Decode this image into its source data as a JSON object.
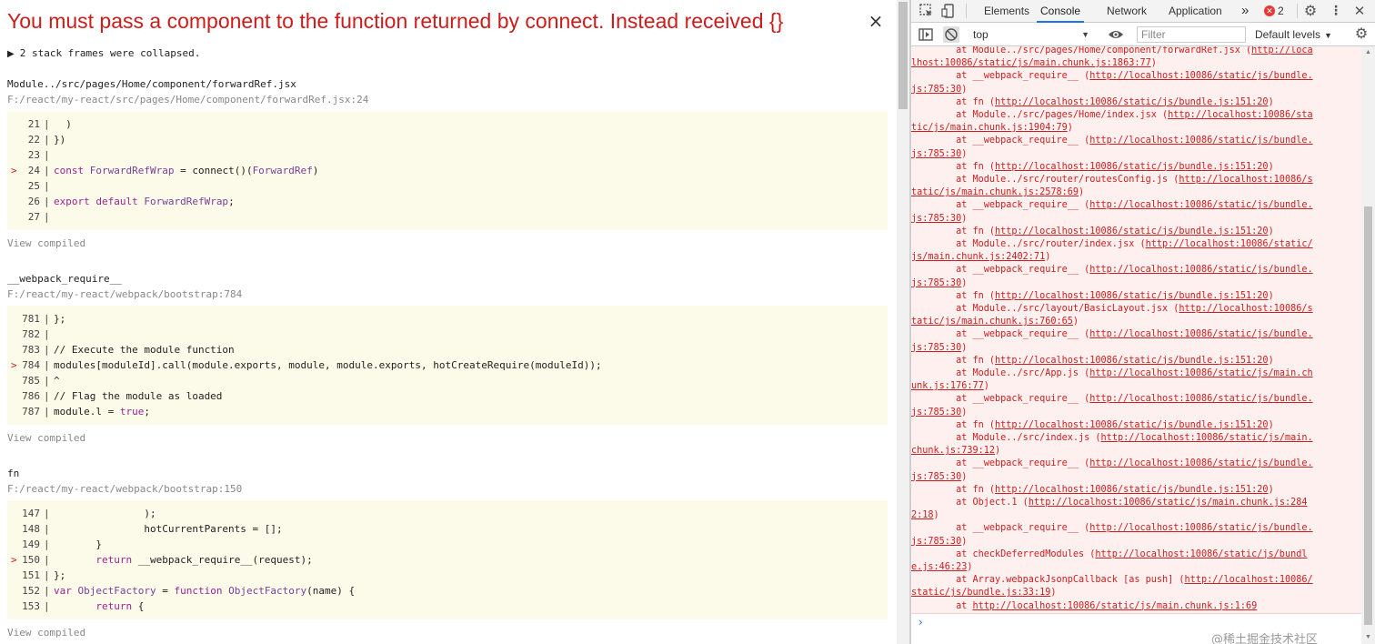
{
  "overlay": {
    "title": "You must pass a component to the function returned by connect. Instead received {}",
    "close_glyph": "×",
    "collapsed": "2 stack frames were collapsed.",
    "view_compiled": "View compiled",
    "frames": [
      {
        "name": "Module../src/pages/Home/component/forwardRef.jsx",
        "file": "F:/react/my-react/src/pages/Home/component/forwardRef.jsx:24",
        "lines": [
          {
            "n": "21",
            "mark": false,
            "parts": [
              {
                "t": "  )",
                "c": ""
              }
            ]
          },
          {
            "n": "22",
            "mark": false,
            "parts": [
              {
                "t": "})",
                "c": ""
              }
            ]
          },
          {
            "n": "23",
            "mark": false,
            "parts": [
              {
                "t": "",
                "c": ""
              }
            ]
          },
          {
            "n": "24",
            "mark": true,
            "parts": [
              {
                "t": "const ",
                "c": "kw"
              },
              {
                "t": "ForwardRefWrap",
                "c": "id"
              },
              {
                "t": " = connect()(",
                "c": ""
              },
              {
                "t": "ForwardRef",
                "c": "id"
              },
              {
                "t": ")",
                "c": ""
              }
            ]
          },
          {
            "n": "25",
            "mark": false,
            "parts": [
              {
                "t": "",
                "c": ""
              }
            ]
          },
          {
            "n": "26",
            "mark": false,
            "parts": [
              {
                "t": "export default ",
                "c": "kw"
              },
              {
                "t": "ForwardRefWrap",
                "c": "id"
              },
              {
                "t": ";",
                "c": ""
              }
            ]
          },
          {
            "n": "27",
            "mark": false,
            "parts": [
              {
                "t": "",
                "c": ""
              }
            ]
          }
        ]
      },
      {
        "name": "__webpack_require__",
        "file": "F:/react/my-react/webpack/bootstrap:784",
        "lines": [
          {
            "n": "781",
            "mark": false,
            "parts": [
              {
                "t": "};",
                "c": ""
              }
            ]
          },
          {
            "n": "782",
            "mark": false,
            "parts": [
              {
                "t": "",
                "c": ""
              }
            ]
          },
          {
            "n": "783",
            "mark": false,
            "parts": [
              {
                "t": "// Execute the module function",
                "c": ""
              }
            ]
          },
          {
            "n": "784",
            "mark": true,
            "parts": [
              {
                "t": "modules[moduleId].call(module.exports, module, module.exports, hotCreateRequire(moduleId));",
                "c": ""
              }
            ]
          },
          {
            "n": "785",
            "mark": false,
            "parts": [
              {
                "t": "^",
                "c": ""
              }
            ]
          },
          {
            "n": "786",
            "mark": false,
            "parts": [
              {
                "t": "// Flag the module as loaded",
                "c": ""
              }
            ]
          },
          {
            "n": "787",
            "mark": false,
            "parts": [
              {
                "t": "module.l = ",
                "c": ""
              },
              {
                "t": "true",
                "c": "kw"
              },
              {
                "t": ";",
                "c": ""
              }
            ]
          }
        ]
      },
      {
        "name": "fn",
        "file": "F:/react/my-react/webpack/bootstrap:150",
        "lines": [
          {
            "n": "147",
            "mark": false,
            "parts": [
              {
                "t": "               );",
                "c": ""
              }
            ]
          },
          {
            "n": "148",
            "mark": false,
            "parts": [
              {
                "t": "               hotCurrentParents = [];",
                "c": ""
              }
            ]
          },
          {
            "n": "149",
            "mark": false,
            "parts": [
              {
                "t": "       }",
                "c": ""
              }
            ]
          },
          {
            "n": "150",
            "mark": true,
            "parts": [
              {
                "t": "       ",
                "c": ""
              },
              {
                "t": "return",
                "c": "kw"
              },
              {
                "t": " __webpack_require__(request);",
                "c": ""
              }
            ]
          },
          {
            "n": "151",
            "mark": false,
            "parts": [
              {
                "t": "};",
                "c": ""
              }
            ]
          },
          {
            "n": "152",
            "mark": false,
            "parts": [
              {
                "t": "var ",
                "c": "kw"
              },
              {
                "t": "ObjectFactory",
                "c": "id"
              },
              {
                "t": " = ",
                "c": ""
              },
              {
                "t": "function ",
                "c": "kw"
              },
              {
                "t": "ObjectFactory",
                "c": "id"
              },
              {
                "t": "(name) {",
                "c": ""
              }
            ]
          },
          {
            "n": "153",
            "mark": false,
            "parts": [
              {
                "t": "       ",
                "c": ""
              },
              {
                "t": "return",
                "c": "kw"
              },
              {
                "t": " {",
                "c": ""
              }
            ]
          }
        ]
      }
    ]
  },
  "devtools": {
    "tabs": [
      "Elements",
      "Console",
      "Network",
      "Application"
    ],
    "active_tab": "Console",
    "more_tabs": "»",
    "error_count": "2",
    "context": "top",
    "filter_placeholder": "Filter",
    "levels": "Default levels",
    "watermark": "@稀土掘金技术社区",
    "colors": {
      "error_text": "#cc2020",
      "error_bg": "#fff0f0",
      "accent": "#1a73e8"
    },
    "log_lines": [
      [
        {
          "t": "        at Module../src/pages/Home/component/forwardRef.jsx ("
        },
        {
          "t": "http://loca",
          "l": true
        }
      ],
      [
        {
          "t": "lhost:10086/static/js/main.chunk.js:1863:77",
          "l": true
        },
        {
          "t": ")"
        }
      ],
      [
        {
          "t": "        at __webpack_require__ ("
        },
        {
          "t": "http://localhost:10086/static/js/bundle.",
          "l": true
        }
      ],
      [
        {
          "t": "js:785:30",
          "l": true
        },
        {
          "t": ")"
        }
      ],
      [
        {
          "t": "        at fn ("
        },
        {
          "t": "http://localhost:10086/static/js/bundle.js:151:20",
          "l": true
        },
        {
          "t": ")"
        }
      ],
      [
        {
          "t": "        at Module../src/pages/Home/index.jsx ("
        },
        {
          "t": "http://localhost:10086/sta",
          "l": true
        }
      ],
      [
        {
          "t": "tic/js/main.chunk.js:1904:79",
          "l": true
        },
        {
          "t": ")"
        }
      ],
      [
        {
          "t": "        at __webpack_require__ ("
        },
        {
          "t": "http://localhost:10086/static/js/bundle.",
          "l": true
        }
      ],
      [
        {
          "t": "js:785:30",
          "l": true
        },
        {
          "t": ")"
        }
      ],
      [
        {
          "t": "        at fn ("
        },
        {
          "t": "http://localhost:10086/static/js/bundle.js:151:20",
          "l": true
        },
        {
          "t": ")"
        }
      ],
      [
        {
          "t": "        at Module../src/router/routesConfig.js ("
        },
        {
          "t": "http://localhost:10086/s",
          "l": true
        }
      ],
      [
        {
          "t": "tatic/js/main.chunk.js:2578:69",
          "l": true
        },
        {
          "t": ")"
        }
      ],
      [
        {
          "t": "        at __webpack_require__ ("
        },
        {
          "t": "http://localhost:10086/static/js/bundle.",
          "l": true
        }
      ],
      [
        {
          "t": "js:785:30",
          "l": true
        },
        {
          "t": ")"
        }
      ],
      [
        {
          "t": "        at fn ("
        },
        {
          "t": "http://localhost:10086/static/js/bundle.js:151:20",
          "l": true
        },
        {
          "t": ")"
        }
      ],
      [
        {
          "t": "        at Module../src/router/index.jsx ("
        },
        {
          "t": "http://localhost:10086/static/",
          "l": true
        }
      ],
      [
        {
          "t": "js/main.chunk.js:2402:71",
          "l": true
        },
        {
          "t": ")"
        }
      ],
      [
        {
          "t": "        at __webpack_require__ ("
        },
        {
          "t": "http://localhost:10086/static/js/bundle.",
          "l": true
        }
      ],
      [
        {
          "t": "js:785:30",
          "l": true
        },
        {
          "t": ")"
        }
      ],
      [
        {
          "t": "        at fn ("
        },
        {
          "t": "http://localhost:10086/static/js/bundle.js:151:20",
          "l": true
        },
        {
          "t": ")"
        }
      ],
      [
        {
          "t": "        at Module../src/layout/BasicLayout.jsx ("
        },
        {
          "t": "http://localhost:10086/s",
          "l": true
        }
      ],
      [
        {
          "t": "tatic/js/main.chunk.js:760:65",
          "l": true
        },
        {
          "t": ")"
        }
      ],
      [
        {
          "t": "        at __webpack_require__ ("
        },
        {
          "t": "http://localhost:10086/static/js/bundle.",
          "l": true
        }
      ],
      [
        {
          "t": "js:785:30",
          "l": true
        },
        {
          "t": ")"
        }
      ],
      [
        {
          "t": "        at fn ("
        },
        {
          "t": "http://localhost:10086/static/js/bundle.js:151:20",
          "l": true
        },
        {
          "t": ")"
        }
      ],
      [
        {
          "t": "        at Module../src/App.js ("
        },
        {
          "t": "http://localhost:10086/static/js/main.ch",
          "l": true
        }
      ],
      [
        {
          "t": "unk.js:176:77",
          "l": true
        },
        {
          "t": ")"
        }
      ],
      [
        {
          "t": "        at __webpack_require__ ("
        },
        {
          "t": "http://localhost:10086/static/js/bundle.",
          "l": true
        }
      ],
      [
        {
          "t": "js:785:30",
          "l": true
        },
        {
          "t": ")"
        }
      ],
      [
        {
          "t": "        at fn ("
        },
        {
          "t": "http://localhost:10086/static/js/bundle.js:151:20",
          "l": true
        },
        {
          "t": ")"
        }
      ],
      [
        {
          "t": "        at Module../src/index.js ("
        },
        {
          "t": "http://localhost:10086/static/js/main.",
          "l": true
        }
      ],
      [
        {
          "t": "chunk.js:739:12",
          "l": true
        },
        {
          "t": ")"
        }
      ],
      [
        {
          "t": "        at __webpack_require__ ("
        },
        {
          "t": "http://localhost:10086/static/js/bundle.",
          "l": true
        }
      ],
      [
        {
          "t": "js:785:30",
          "l": true
        },
        {
          "t": ")"
        }
      ],
      [
        {
          "t": "        at fn ("
        },
        {
          "t": "http://localhost:10086/static/js/bundle.js:151:20",
          "l": true
        },
        {
          "t": ")"
        }
      ],
      [
        {
          "t": "        at Object.1 ("
        },
        {
          "t": "http://localhost:10086/static/js/main.chunk.js:284",
          "l": true
        }
      ],
      [
        {
          "t": "2:18",
          "l": true
        },
        {
          "t": ")"
        }
      ],
      [
        {
          "t": "        at __webpack_require__ ("
        },
        {
          "t": "http://localhost:10086/static/js/bundle.",
          "l": true
        }
      ],
      [
        {
          "t": "js:785:30",
          "l": true
        },
        {
          "t": ")"
        }
      ],
      [
        {
          "t": "        at checkDeferredModules ("
        },
        {
          "t": "http://localhost:10086/static/js/bundl",
          "l": true
        }
      ],
      [
        {
          "t": "e.js:46:23",
          "l": true
        },
        {
          "t": ")"
        }
      ],
      [
        {
          "t": "        at Array.webpackJsonpCallback [as push] ("
        },
        {
          "t": "http://localhost:10086/",
          "l": true
        }
      ],
      [
        {
          "t": "static/js/bundle.js:33:19",
          "l": true
        },
        {
          "t": ")"
        }
      ],
      [
        {
          "t": "        at "
        },
        {
          "t": "http://localhost:10086/static/js/main.chunk.js:1:69",
          "l": true
        }
      ]
    ]
  }
}
